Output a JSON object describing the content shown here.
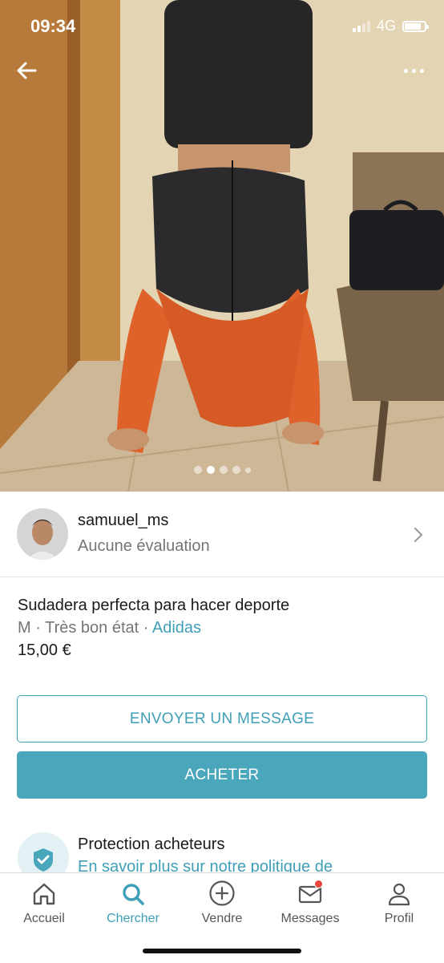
{
  "status_bar": {
    "time": "09:34",
    "network": "4G",
    "battery_level": 0.85
  },
  "gallery": {
    "photo_count": 5,
    "active_index": 1
  },
  "seller": {
    "username": "samuuel_ms",
    "rating": "Aucune évaluation"
  },
  "item": {
    "title": "Sudadera perfecta para hacer deporte",
    "size": "M",
    "separator": " · ",
    "condition": "Très bon état",
    "brand": "Adidas",
    "price": "15,00 €"
  },
  "actions": {
    "message_label": "ENVOYER UN MESSAGE",
    "buy_label": "ACHETER"
  },
  "protection": {
    "title": "Protection acheteurs",
    "link": "En savoir plus sur notre politique de"
  },
  "nav": {
    "items": [
      {
        "label": "Accueil",
        "icon": "home-icon"
      },
      {
        "label": "Chercher",
        "icon": "search-icon"
      },
      {
        "label": "Vendre",
        "icon": "plus-circle-icon"
      },
      {
        "label": "Messages",
        "icon": "mail-icon"
      },
      {
        "label": "Profil",
        "icon": "person-icon"
      }
    ],
    "active": "Chercher",
    "accent_color": "#3f9fb7",
    "badge_color": "#e8443a"
  }
}
